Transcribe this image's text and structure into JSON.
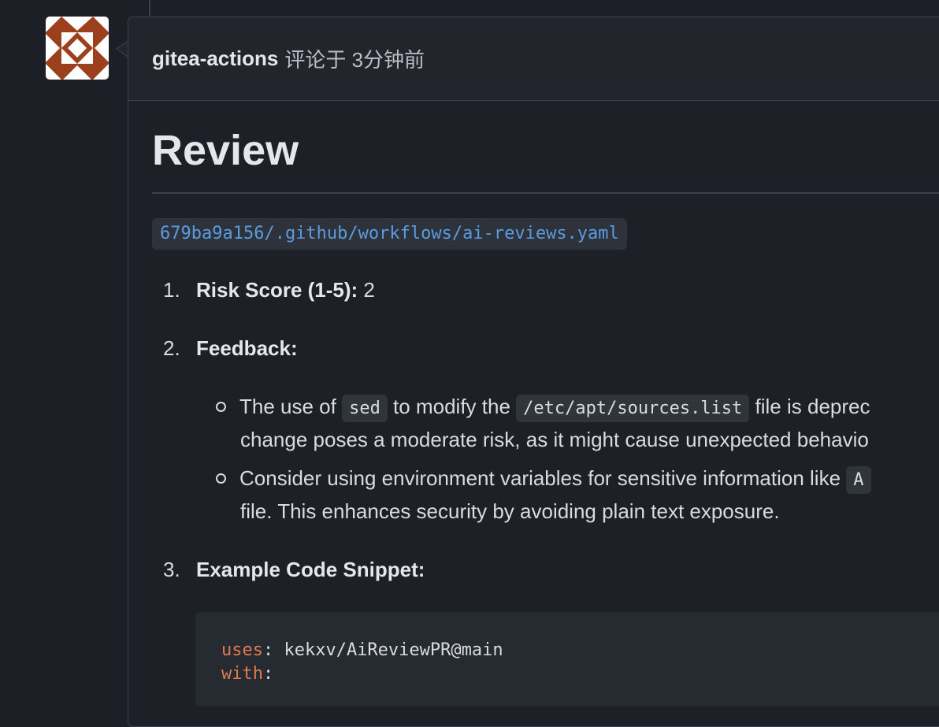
{
  "comment": {
    "author": "gitea-actions",
    "meta": "评论于 3分钟前",
    "title": "Review",
    "file_ref": "679ba9a156/.github/workflows/ai-reviews.yaml",
    "items": [
      {
        "number": "1.",
        "label": "Risk Score (1-5):",
        "value": " 2"
      },
      {
        "number": "2.",
        "label": "Feedback:"
      },
      {
        "number": "3.",
        "label": "Example Code Snippet:"
      }
    ],
    "feedback": {
      "b1_pre": "The use of ",
      "b1_code1": "sed",
      "b1_mid": " to modify the ",
      "b1_code2": "/etc/apt/sources.list",
      "b1_post": " file is deprec",
      "b1_line2": "change poses a moderate risk, as it might cause unexpected behavio",
      "b2_pre": "Consider using environment variables for sensitive information like ",
      "b2_code": "A",
      "b2_line2": "file. This enhances security by avoiding plain text exposure."
    },
    "code": {
      "line1_key": "uses",
      "line1_rest": ": kekxv/AiReviewPR@main",
      "line2_key": "with",
      "line2_rest": ":"
    }
  },
  "colors": {
    "background": "#1c2026",
    "link": "#5b9be0",
    "code_keyword": "#e07b4f",
    "avatar": "#9b3f1d"
  },
  "icons": {
    "avatar": "identicon-avatar"
  }
}
